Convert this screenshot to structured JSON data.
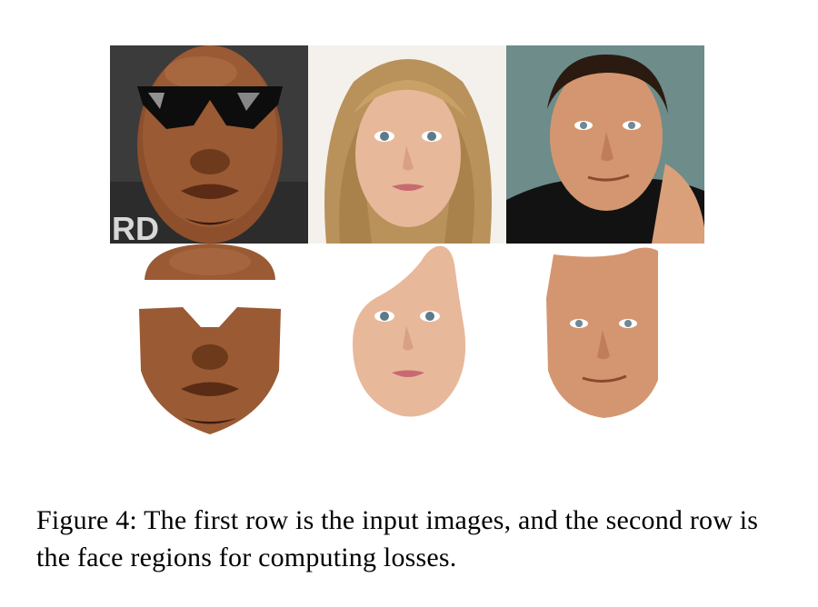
{
  "figure": {
    "rows": [
      {
        "label": "input images",
        "items": [
          {
            "subject": "man with dark sunglasses",
            "background_text": "RD"
          },
          {
            "subject": "blonde woman"
          },
          {
            "subject": "man in black turtleneck"
          }
        ]
      },
      {
        "label": "face regions for computing losses",
        "items": [
          {
            "subject": "masked face of man with sunglasses (glasses removed)"
          },
          {
            "subject": "masked face of blonde woman"
          },
          {
            "subject": "masked face of man in turtleneck"
          }
        ]
      }
    ]
  },
  "caption": {
    "text": "Figure 4: The first row is the input images, and the second row is the face regions for computing losses."
  },
  "colors": {
    "skin_dark": "#9a5a34",
    "skin_light": "#e8b89a",
    "skin_tan": "#c98560",
    "hair_blonde": "#b8925a",
    "background_gray": "#3a3a3a",
    "background_teal": "#6d8c8a"
  }
}
